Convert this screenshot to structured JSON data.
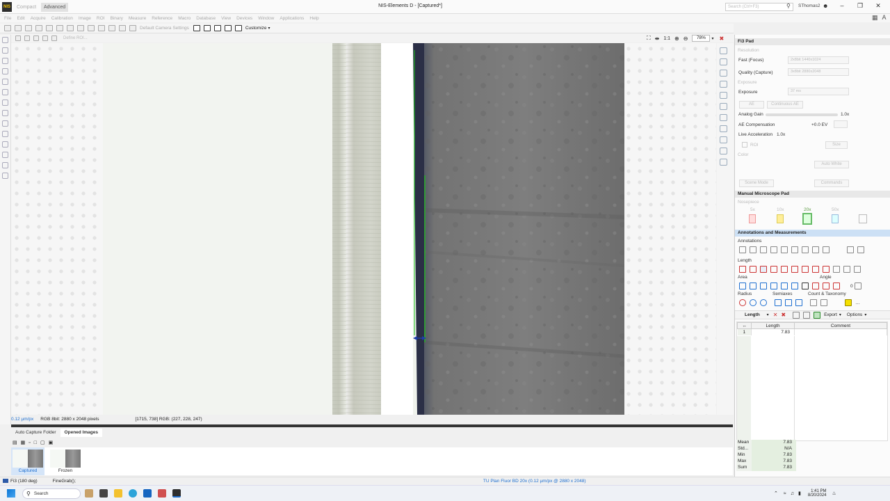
{
  "app": {
    "logo": "NIS",
    "modes": [
      "Compact",
      "Advanced"
    ],
    "title": "NIS-Elements D  - [Captured*]",
    "search_placeholder": "Search (Ctrl+F3)",
    "user": "SThomas2"
  },
  "menu": [
    "File",
    "Edit",
    "Acquire",
    "Calibration",
    "Image",
    "ROI",
    "Binary",
    "Measure",
    "Reference",
    "Macro",
    "Database",
    "View",
    "Devices",
    "Window",
    "Applications",
    "Help"
  ],
  "toolbar": {
    "camera_settings": "Default Camera Settings",
    "customize": "Customize",
    "define_roi": "Define ROI..."
  },
  "view": {
    "ratio": "1:1",
    "zoom": "78%"
  },
  "status": {
    "calibration": "0.12 µm/px",
    "format": "RGB 8bit: 2880 x 2048 pixels",
    "pixel": "[1715, 738] RGB: (227, 228, 247)"
  },
  "bottom_tabs": [
    "Auto Capture Folder",
    "Opened Images"
  ],
  "thumbnails": [
    "Captured",
    "Frozen"
  ],
  "app_status": {
    "camera": "Fi3 (180 deg)",
    "command": "FineGrab();",
    "objective": "TU Plan Fluor BD 20x (0.12 µm/px @ 2880 x 2048)"
  },
  "taskbar": {
    "search": "Search",
    "time": "1:41 PM",
    "date": "8/20/2024"
  },
  "fi3pad": {
    "title": "Fi3 Pad",
    "resolution_label": "Resolution",
    "fast_label": "Fast (Focus)",
    "fast_value": "2x8bit 1440x1024",
    "quality_label": "Quality (Capture)",
    "quality_value": "3x8bit 2880x2048",
    "exposure_section": "Exposure",
    "exposure_label": "Exposure",
    "exposure_value": "37 ms",
    "ae": "AE",
    "continuous_ae": "Continuous AE",
    "gain_label": "Analog Gain",
    "gain_value": "1.0x",
    "ae_comp_label": "AE Compensation",
    "ae_comp_value": "+0.0 EV",
    "live_accel_label": "Live Acceleration",
    "live_accel_value": "1.0x",
    "roi": "ROI",
    "size": "Size",
    "color_label": "Color",
    "auto_white": "Auto White",
    "scene_mode": "Scene Mode",
    "commands": "Commands"
  },
  "microscope": {
    "title": "Manual Microscope Pad",
    "nosepiece": "Nosepiece",
    "objectives": [
      "5x",
      "10x",
      "20x",
      "50x"
    ],
    "active_objective": "20x"
  },
  "annotations": {
    "title": "Annotations and Measurements",
    "annotations_label": "Annotations",
    "length_label": "Length",
    "area_label": "Area",
    "angle_label": "Angle",
    "angle_zero": "0",
    "radius_label": "Radius",
    "semiaxes_label": "Semiaxes",
    "count_label": "Count & Taxonomy",
    "feature_select": "Length",
    "export": "Export",
    "options": "Options"
  },
  "table": {
    "headers": [
      "Length",
      "Comment"
    ],
    "rows": [
      {
        "id": "1",
        "length": "7.83",
        "comment": ""
      }
    ]
  },
  "stats": [
    {
      "key": "Mean",
      "value": "7.83"
    },
    {
      "key": "Std...",
      "value": "N/A"
    },
    {
      "key": "Min",
      "value": "7.83"
    },
    {
      "key": "Max",
      "value": "7.83"
    },
    {
      "key": "Sum",
      "value": "7.83"
    }
  ],
  "colors": {
    "measure_line": "#17c417",
    "accent": "#1e6fd0",
    "selected_header": "#cce0f5"
  }
}
